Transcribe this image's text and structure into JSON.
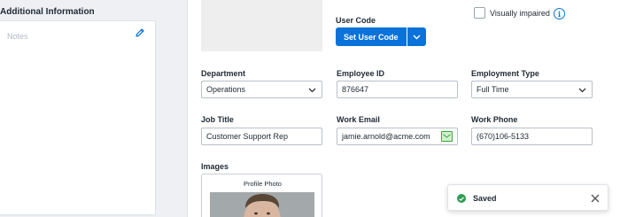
{
  "left_panel": {
    "title": "Additional Information",
    "notes_placeholder": "Notes"
  },
  "user_code": {
    "label": "User Code",
    "button_label": "Set User Code"
  },
  "visually_impaired": {
    "label": "Visually impaired",
    "checked": false,
    "info_glyph": "i"
  },
  "fields": {
    "department": {
      "label": "Department",
      "value": "Operations"
    },
    "employee_id": {
      "label": "Employee ID",
      "value": "876647"
    },
    "employment_type": {
      "label": "Employment Type",
      "value": "Full Time"
    },
    "job_title": {
      "label": "Job Title",
      "value": "Customer Support Rep"
    },
    "work_email": {
      "label": "Work Email",
      "value": "jamie.arnold@acme.com"
    },
    "work_phone": {
      "label": "Work Phone",
      "value": "(670)106-5133"
    }
  },
  "images": {
    "label": "Images",
    "caption": "Profile Photo"
  },
  "toast": {
    "message": "Saved"
  },
  "colors": {
    "primary": "#0b72d9",
    "success": "#2e9e4f",
    "email_icon_border": "#3ca63a",
    "email_icon_fill": "#d4efd0"
  },
  "icons": {
    "notes_edit": "pencil-icon",
    "split_arrow": "chevron-down-icon",
    "info": "info-icon",
    "select_arrow": "chevron-down-icon",
    "email": "envelope-icon",
    "toast_status": "check-circle-icon",
    "toast_close": "close-icon"
  }
}
